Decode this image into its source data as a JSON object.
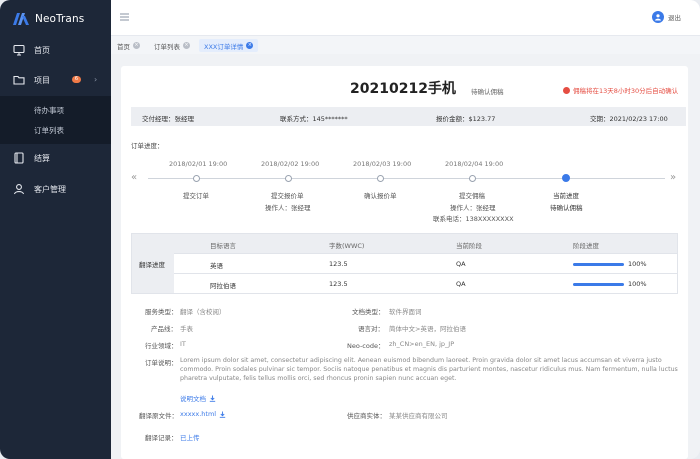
{
  "app": {
    "name": "NeoTrans"
  },
  "sidebar": {
    "items": [
      {
        "label": "首页",
        "icon": "monitor-icon"
      },
      {
        "label": "项目",
        "icon": "folder-icon",
        "badge": "6"
      },
      {
        "label": "结算",
        "icon": "book-icon"
      },
      {
        "label": "客户管理",
        "icon": "user-icon"
      }
    ],
    "subitems": [
      {
        "label": "待办事项"
      },
      {
        "label": "订单列表"
      }
    ]
  },
  "header": {
    "user_label": "退出"
  },
  "tabs": [
    {
      "label": "首页"
    },
    {
      "label": "订单列表"
    },
    {
      "label": "XXX订单详情"
    }
  ],
  "order": {
    "title": "20210212手机",
    "status": "待确认佣稿",
    "auto_close": "佣稿将在13天8小时30分后自动确认"
  },
  "info": {
    "manager": "交付经理：张经理",
    "contact": "联系方式：145*******",
    "price": "报价金额：$123.77",
    "date": "交期：2021/02/23 17:00"
  },
  "progress": {
    "label": "订单进度：",
    "steps": [
      {
        "date": "2018/02/01 19:00",
        "title": "提交订单",
        "sub1": "",
        "sub2": ""
      },
      {
        "date": "2018/02/02 19:00",
        "title": "提交报价单",
        "sub1": "操作人：张经理",
        "sub2": ""
      },
      {
        "date": "2018/02/03 19:00",
        "title": "确认报价单",
        "sub1": "",
        "sub2": ""
      },
      {
        "date": "2018/02/04 19:00",
        "title": "提交佣稿",
        "sub1": "操作人：张经理",
        "sub2": "联系电话：138XXXXXXXX"
      },
      {
        "date": "",
        "title": "当前进度",
        "sub1": "待确认佣稿",
        "sub2": ""
      }
    ]
  },
  "translation_table": {
    "row_label": "翻译进度",
    "headers": [
      "目标语言",
      "字数(WWC)",
      "当前阶段",
      "阶段进度"
    ],
    "rows": [
      {
        "lang": "英语",
        "words": "123.5",
        "stage": "QA",
        "progress": 100,
        "progress_text": "100%"
      },
      {
        "lang": "阿拉伯语",
        "words": "123.5",
        "stage": "QA",
        "progress": 100,
        "progress_text": "100%"
      }
    ]
  },
  "details": {
    "service_type_label": "服务类型：",
    "service_type": "翻译（含校阅）",
    "doc_type_label": "文档类型：",
    "doc_type": "软件界面词",
    "product_label": "产品线：",
    "product": "手表",
    "lang_pair_label": "语言对：",
    "lang_pair": "简体中文>英语，阿拉伯语",
    "industry_label": "行业领域：",
    "industry": "IT",
    "neo_code_label": "Neo-code：",
    "neo_code": "zh_CN>en_EN, jp_JP",
    "desc_label": "订单说明：",
    "desc": "Lorem ipsum dolor sit amet, consectetur adipiscing elit. Aenean euismod bibendum laoreet. Proin gravida dolor sit amet lacus accumsan et viverra justo commodo. Proin sodales pulvinar sic tempor. Sociis natoque penatibus et magnis dis parturient montes, nascetur ridiculus mus. Nam fermentum, nulla luctus pharetra vulputate, felis tellus mollis orci, sed rhoncus pronin sapien nunc accuan eget.",
    "desc_doc_link": "说明文档",
    "source_file_label": "翻译原文件：",
    "source_file": "xxxxx.html",
    "supplier_label": "供应商实体：",
    "supplier": "某某供应商有限公司",
    "record_label": "翻译记录：",
    "record": "已上传"
  },
  "colors": {
    "accent": "#3b7ae8",
    "sidebar": "#1d2738",
    "alert": "#e54d42"
  }
}
